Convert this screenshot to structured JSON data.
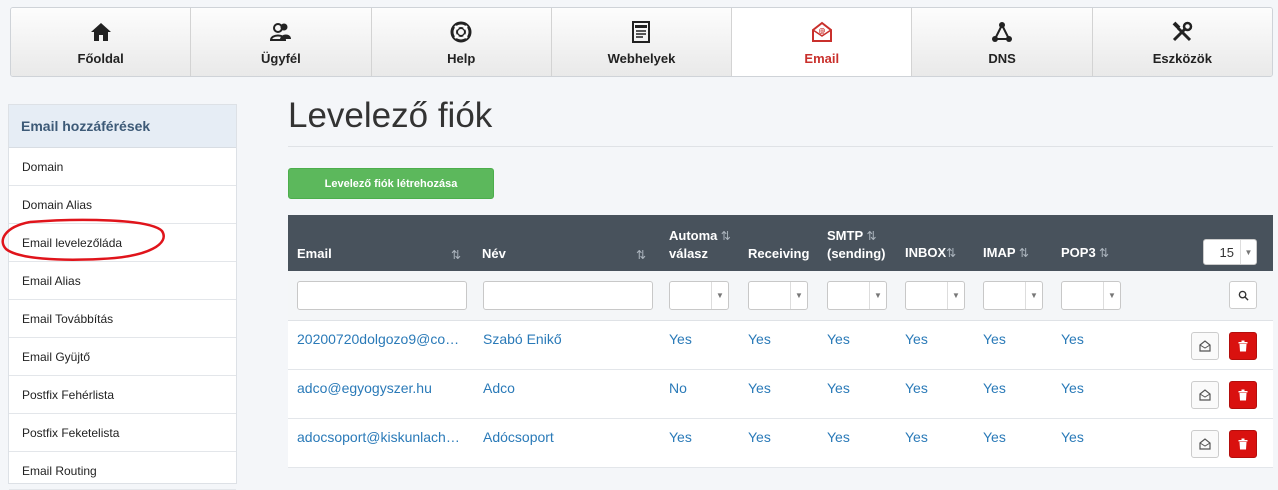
{
  "nav": {
    "items": [
      {
        "label": "Főoldal",
        "icon": "home-icon"
      },
      {
        "label": "Ügyfél",
        "icon": "users-icon"
      },
      {
        "label": "Help",
        "icon": "lifebuoy-icon"
      },
      {
        "label": "Webhelyek",
        "icon": "browser-window-icon"
      },
      {
        "label": "Email",
        "icon": "email-envelope-icon"
      },
      {
        "label": "DNS",
        "icon": "network-icon"
      },
      {
        "label": "Eszközök",
        "icon": "tools-icon"
      }
    ],
    "active": "Email",
    "active_color": "#c9302c"
  },
  "sidebar": {
    "header": "Email hozzáférések",
    "items": [
      {
        "label": "Domain"
      },
      {
        "label": "Domain Alias"
      },
      {
        "label": "Email levelezőláda"
      },
      {
        "label": "Email Alias"
      },
      {
        "label": "Email Továbbítás"
      },
      {
        "label": "Email Gyüjtő"
      },
      {
        "label": "Postfix Fehérlista"
      },
      {
        "label": "Postfix Feketelista"
      },
      {
        "label": "Email Routing"
      }
    ],
    "highlight_color": "#e0141b"
  },
  "main": {
    "title": "Levelező fiók",
    "create_button": "Levelező fiók létrehozása",
    "page_size": "15",
    "columns": [
      {
        "line1": "Email",
        "line2": ""
      },
      {
        "line1": "Név",
        "line2": ""
      },
      {
        "line1": "Automa",
        "line2": "válasz"
      },
      {
        "line1": "Receiving",
        "line2": ""
      },
      {
        "line1": "SMTP",
        "line2": "(sending)"
      },
      {
        "line1": "INBOX",
        "line2": ""
      },
      {
        "line1": "IMAP",
        "line2": ""
      },
      {
        "line1": "POP3",
        "line2": ""
      }
    ],
    "rows": [
      {
        "email": "20200720dolgozo9@co…",
        "name": "Szabó Enikő",
        "auto": "Yes",
        "receiving": "Yes",
        "smtp": "Yes",
        "inbox": "Yes",
        "imap": "Yes",
        "pop3": "Yes"
      },
      {
        "email": "adco@egyogyszer.hu",
        "name": "Adco",
        "auto": "No",
        "receiving": "Yes",
        "smtp": "Yes",
        "inbox": "Yes",
        "imap": "Yes",
        "pop3": "Yes"
      },
      {
        "email": "adocsoport@kiskunlach…",
        "name": "Adócsoport",
        "auto": "Yes",
        "receiving": "Yes",
        "smtp": "Yes",
        "inbox": "Yes",
        "imap": "Yes",
        "pop3": "Yes"
      }
    ]
  },
  "colors": {
    "link": "#2a7ab8",
    "header_bg": "#48525c",
    "create_button": "#5cb85c",
    "delete_button": "#d9110f"
  }
}
